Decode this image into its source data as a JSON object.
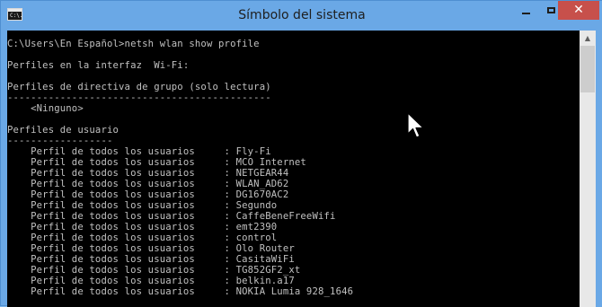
{
  "window": {
    "title": "Símbolo del sistema",
    "icon": "cmd-icon",
    "icon_text": "C:\\.",
    "controls": [
      "minimize-icon",
      "maximize-icon",
      "close-icon"
    ],
    "close_glyph": "✕"
  },
  "console": {
    "lines": [
      "C:\\Users\\En Español>netsh wlan show profile",
      "",
      "Perfiles en la interfaz  Wi-Fi:",
      "",
      "Perfiles de directiva de grupo (solo lectura)",
      "---------------------------------------------",
      "    <Ninguno>",
      "",
      "Perfiles de usuario",
      "------------------",
      "    Perfil de todos los usuarios     : Fly-Fi",
      "    Perfil de todos los usuarios     : MCO Internet",
      "    Perfil de todos los usuarios     : NETGEAR44",
      "    Perfil de todos los usuarios     : WLAN_AD62",
      "    Perfil de todos los usuarios     : DG1670AC2",
      "    Perfil de todos los usuarios     : Segundo",
      "    Perfil de todos los usuarios     : CaffeBeneFreeWifi",
      "    Perfil de todos los usuarios     : emt2390",
      "    Perfil de todos los usuarios     : control",
      "    Perfil de todos los usuarios     : Olo Router",
      "    Perfil de todos los usuarios     : CasitaWiFi",
      "    Perfil de todos los usuarios     : TG852GF2_xt",
      "    Perfil de todos los usuarios     : belkin.a17",
      "    Perfil de todos los usuarios     : NOKIA Lumia 928_1646"
    ]
  },
  "scrollbar": {
    "up_arrow": "▲"
  },
  "colors": {
    "console_bg": "#000000",
    "console_text": "#c0c0c0",
    "titlebar": "#6aa8e6",
    "close": "#c7504b"
  }
}
